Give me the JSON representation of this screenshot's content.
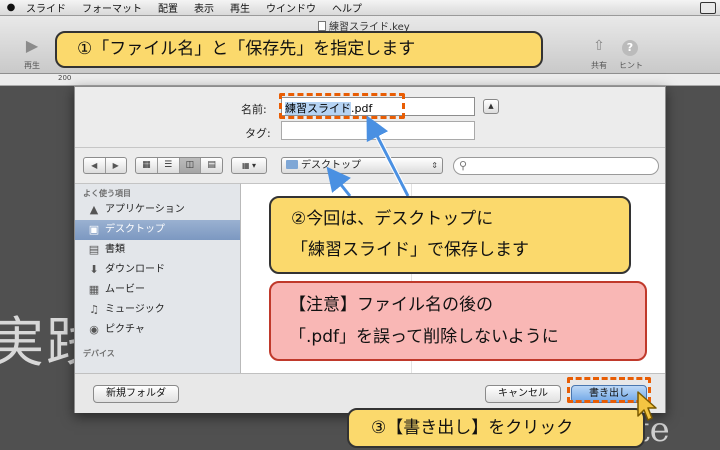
{
  "menubar": {
    "items": [
      "スライド",
      "フォーマット",
      "配置",
      "表示",
      "再生",
      "ウインドウ",
      "ヘルプ"
    ]
  },
  "toolbar": {
    "document_title": "練習スライド.key",
    "play_label": "再生",
    "share_label": "共有",
    "hint_label": "ヒント"
  },
  "ruler": {
    "mark": "200"
  },
  "slide": {
    "text_left": "実践",
    "text_right": "te"
  },
  "dialog": {
    "name_label": "名前:",
    "name_value_selected": "練習スライド",
    "name_value_ext": ".pdf",
    "tag_label": "タグ:",
    "location": "デスクトップ",
    "sidebar": {
      "favorites_header": "よく使う項目",
      "devices_header": "デバイス",
      "items": [
        {
          "label": "アプリケーション",
          "icon": "applications-icon"
        },
        {
          "label": "デスクトップ",
          "icon": "desktop-icon",
          "selected": true
        },
        {
          "label": "書類",
          "icon": "documents-icon"
        },
        {
          "label": "ダウンロード",
          "icon": "downloads-icon"
        },
        {
          "label": "ムービー",
          "icon": "movies-icon"
        },
        {
          "label": "ミュージック",
          "icon": "music-icon"
        },
        {
          "label": "ピクチャ",
          "icon": "pictures-icon"
        }
      ]
    },
    "new_folder_label": "新規フォルダ",
    "cancel_label": "キャンセル",
    "export_label": "書き出し"
  },
  "annotations": {
    "step1": "①「ファイル名」と「保存先」を指定します",
    "step2_line1": "②今回は、デスクトップに",
    "step2_line2": "「練習スライド」で保存します",
    "caution_line1": "【注意】ファイル名の後の",
    "caution_line2": "「.pdf」を誤って削除しないように",
    "step3": "③【書き出し】をクリック"
  },
  "colors": {
    "callout_yellow": "#fbd96c",
    "callout_pink": "#f9b7b5",
    "highlight_dash": "#e85d04",
    "arrow_blue": "#4a90e2"
  }
}
